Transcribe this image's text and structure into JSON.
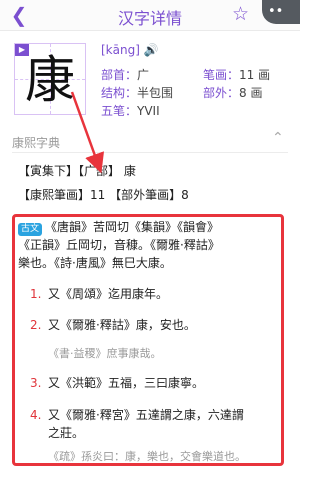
{
  "header": {
    "title": "汉字详情",
    "back_icon": "chevron-left-icon",
    "star_icon": "star-icon",
    "more_icon": "more-icon"
  },
  "character": {
    "glyph": "康",
    "pinyin": "[kāng]",
    "play_label": "▶"
  },
  "details": {
    "bushou_label": "部首：",
    "bushou": "广",
    "bihua_label": "笔画：",
    "bihua": "11 画",
    "jiegou_label": "结构：",
    "jiegou": "半包围",
    "buwai_label": "部外：",
    "buwai": "8 画",
    "wubi_label": "五笔：",
    "wubi": "YVII"
  },
  "kangxi": {
    "section_title": "康熙字典",
    "line1": "【寅集下】【广部】 康",
    "line2": "【康熙筆画】11 【部外筆画】8",
    "badge": "古文",
    "intro1": "《唐韻》苦岡切《集韻》《韻會》",
    "intro2": "《正韻》丘岡切，音穅。《爾雅·釋詁》",
    "intro3": "樂也。《詩·唐風》無巳大康。",
    "items": [
      {
        "num": "1.",
        "text": "又《周頌》迄用康年。"
      },
      {
        "num": "2.",
        "text": "又《爾雅·釋詁》康，安也。"
      },
      {
        "num": "3.",
        "text": "又《洪範》五福，三曰康寧。"
      },
      {
        "num": "4.",
        "text": "又《爾雅·釋宮》五達謂之康，六達謂"
      }
    ],
    "source2": "《書·益稷》庶事康哉。",
    "item4_cont": "之莊。",
    "source4": "《疏》孫炎曰：康，樂也，交會樂道也。"
  },
  "colors": {
    "accent": "#7b4fd0",
    "highlight": "#e8343c"
  }
}
